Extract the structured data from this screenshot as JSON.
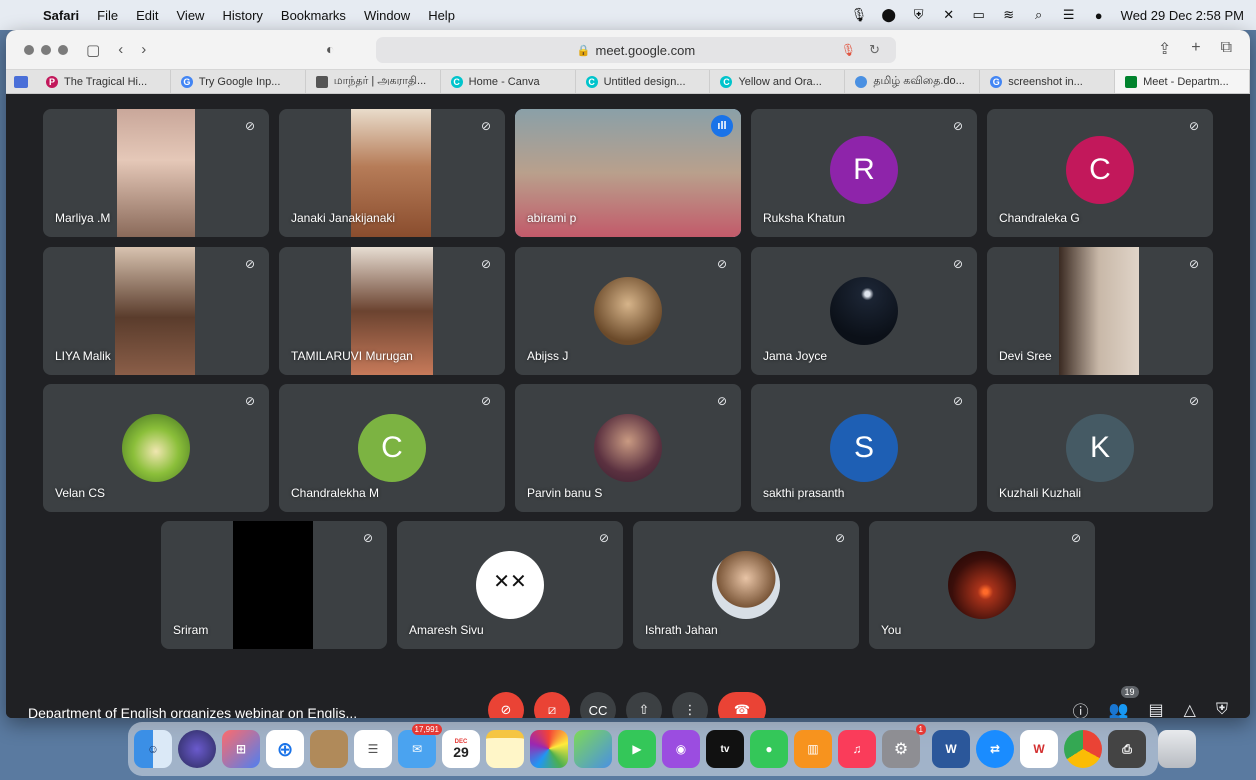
{
  "menubar": {
    "app": "Safari",
    "items": [
      "File",
      "Edit",
      "View",
      "History",
      "Bookmarks",
      "Window",
      "Help"
    ],
    "datetime": "Wed 29 Dec  2:58 PM"
  },
  "browser": {
    "url": "meet.google.com",
    "tabs": [
      {
        "label": "The Tragical Hi...",
        "color": "#c2185b"
      },
      {
        "label": "Try Google Inp...",
        "color": "#4285f4"
      },
      {
        "label": "மாந்தர் | அகராதி...",
        "color": "#555555"
      },
      {
        "label": "Home - Canva",
        "color": "#00c4cc"
      },
      {
        "label": "Untitled design...",
        "color": "#00c4cc"
      },
      {
        "label": "Yellow and Ora...",
        "color": "#00c4cc"
      },
      {
        "label": "தமிழ் கவிதை.do...",
        "color": "#4a90e2"
      },
      {
        "label": "screenshot in...",
        "color": "#4285f4"
      },
      {
        "label": "Meet - Departm...",
        "color": "#00832d",
        "active": true
      }
    ]
  },
  "meet": {
    "title": "Department of English organizes webinar on Englis...",
    "participant_count": "19",
    "row1": [
      {
        "name": "Marliya .M",
        "type": "video"
      },
      {
        "name": "Janaki Janakijanaki",
        "type": "video"
      },
      {
        "name": "abirami p",
        "type": "video",
        "speaking": true
      },
      {
        "name": "Ruksha Khatun",
        "type": "letter",
        "letter": "R",
        "color": "#8e24aa"
      },
      {
        "name": "Chandraleka G",
        "type": "letter",
        "letter": "C",
        "color": "#c2185b"
      }
    ],
    "row2": [
      {
        "name": "LIYA Malik",
        "type": "video"
      },
      {
        "name": "TAMILARUVI Murugan",
        "type": "video"
      },
      {
        "name": "Abijss J",
        "type": "photo"
      },
      {
        "name": "Jama Joyce",
        "type": "photo"
      },
      {
        "name": "Devi Sree",
        "type": "video"
      }
    ],
    "row3": [
      {
        "name": "Velan CS",
        "type": "photo"
      },
      {
        "name": "Chandralekha M",
        "type": "letter",
        "letter": "C",
        "color": "#7cb342"
      },
      {
        "name": "Parvin banu S",
        "type": "photo"
      },
      {
        "name": "sakthi prasanth",
        "type": "letter",
        "letter": "S",
        "color": "#1e5fb4"
      },
      {
        "name": "Kuzhali Kuzhali",
        "type": "letter",
        "letter": "K",
        "color": "#455a64"
      }
    ],
    "row4": [
      {
        "name": "Sriram",
        "type": "video"
      },
      {
        "name": "Amaresh Sivu",
        "type": "photo"
      },
      {
        "name": "Ishrath Jahan",
        "type": "photo"
      },
      {
        "name": "You",
        "type": "photo"
      }
    ]
  },
  "dock": {
    "mail_badge": "17,991",
    "calendar_month": "DEC",
    "calendar_day": "29",
    "settings_badge": "1"
  }
}
